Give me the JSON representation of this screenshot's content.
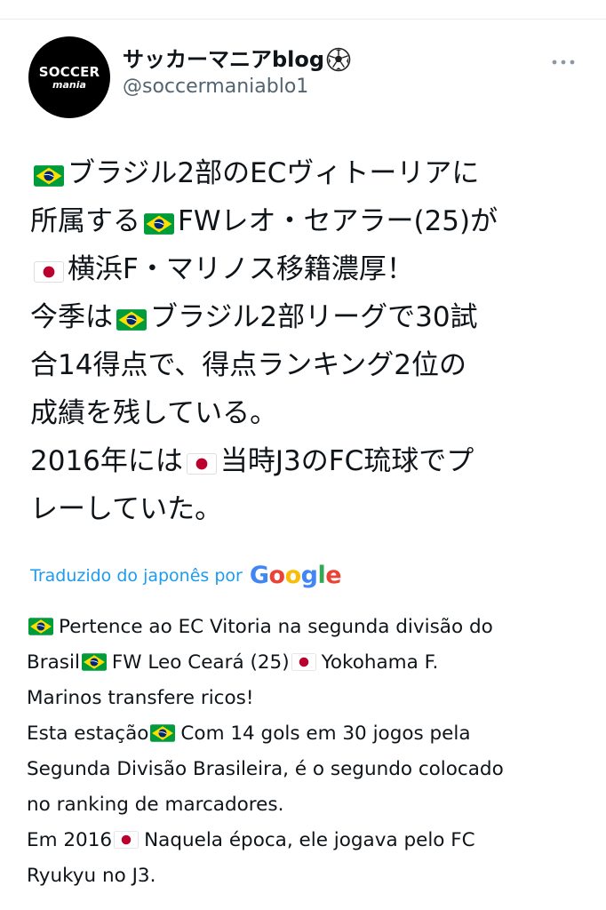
{
  "tweet": {
    "author": {
      "avatar_line1": "SOCCER",
      "avatar_line2": "mania",
      "display_name": "サッカーマニアblog",
      "display_emoji": "soccer-ball-icon",
      "handle": "@soccermaniablo1"
    },
    "more_icon": "more-horizontal-icon",
    "japanese_lines": [
      [
        "[flag-br]",
        "ブラジル2部のECヴィトーリアに"
      ],
      [
        "所属する",
        "[flag-br]",
        "FWレオ・セアラー(25)が"
      ],
      [
        "[flag-jp]",
        "横浜F・マリノス移籍濃厚！"
      ],
      [
        "今季は",
        "[flag-br]",
        "ブラジル2部リーグで30試"
      ],
      [
        "合14得点で、得点ランキング2位の"
      ],
      [
        "成績を残している。"
      ],
      [
        "2016年には",
        "[flag-jp]",
        "当時J3のFC琉球でプ"
      ],
      [
        "レーしていた。"
      ]
    ],
    "translation": {
      "label": "Traduzido do japonês por",
      "provider": "Google"
    },
    "portuguese_lines": [
      [
        "[flag-br]",
        "Pertence ao EC Vitoria na segunda divisão do"
      ],
      [
        "Brasil",
        "[flag-br]",
        "FW Leo Ceará (25)",
        "[flag-jp]",
        "Yokohama F."
      ],
      [
        "Marinos transfere ricos!"
      ],
      [
        " Esta estação",
        "[flag-br]",
        "Com 14 gols em 30 jogos pela"
      ],
      [
        "Segunda Divisão Brasileira, é o segundo colocado"
      ],
      [
        "no ranking de marcadores."
      ],
      [
        " Em 2016",
        "[flag-jp]",
        "Naquela época, ele jogava pelo FC"
      ],
      [
        "Ryukyu no J3."
      ]
    ]
  },
  "colors": {
    "link": "#1d9bf0",
    "text": "#0f1419",
    "secondary": "#536471",
    "divider": "#e6ecf0",
    "brazil_green": "#009c3b",
    "brazil_yellow": "#ffdf00",
    "brazil_blue": "#002776",
    "japan_red": "#bc002d"
  }
}
